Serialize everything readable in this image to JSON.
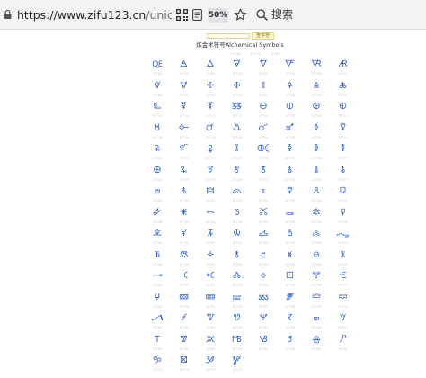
{
  "browser": {
    "url_host": "https://www.zifu123.cn",
    "url_path": "/unicode/Alchemical",
    "zoom": "50%",
    "search_label": "搜索"
  },
  "page": {
    "search_button": "查字符",
    "title": "炼金术符号Alchemical Symbols",
    "subcodes": [
      "1F700",
      "1F701",
      "1F702"
    ]
  },
  "symbols": [
    {
      "g": "🜀",
      "code": "1F700"
    },
    {
      "g": "🜁",
      "code": "1F701"
    },
    {
      "g": "🜂",
      "code": "1F702"
    },
    {
      "g": "🜃",
      "code": "1F703"
    },
    {
      "g": "🜄",
      "code": "1F704"
    },
    {
      "g": "🜅",
      "code": "1F705"
    },
    {
      "g": "🜆",
      "code": "1F706"
    },
    {
      "g": "🜇",
      "code": "1F707"
    },
    {
      "g": "🜈",
      "code": "1F708"
    },
    {
      "g": "🜉",
      "code": "1F709"
    },
    {
      "g": "🜊",
      "code": "1F70A"
    },
    {
      "g": "🜋",
      "code": "1F70B"
    },
    {
      "g": "🜌",
      "code": "1F70C"
    },
    {
      "g": "🜍",
      "code": "1F70D"
    },
    {
      "g": "🜎",
      "code": "1F70E"
    },
    {
      "g": "🜏",
      "code": "1F70F"
    },
    {
      "g": "🜐",
      "code": "1F710"
    },
    {
      "g": "🜑",
      "code": "1F711"
    },
    {
      "g": "🜒",
      "code": "1F712"
    },
    {
      "g": "🜓",
      "code": "1F713"
    },
    {
      "g": "🜔",
      "code": "1F714"
    },
    {
      "g": "🜕",
      "code": "1F715"
    },
    {
      "g": "🜖",
      "code": "1F716"
    },
    {
      "g": "🜗",
      "code": "1F717"
    },
    {
      "g": "🜘",
      "code": "1F718"
    },
    {
      "g": "🜙",
      "code": "1F719"
    },
    {
      "g": "🜚",
      "code": "1F71A"
    },
    {
      "g": "🜛",
      "code": "1F71B"
    },
    {
      "g": "🜜",
      "code": "1F71C"
    },
    {
      "g": "🜝",
      "code": "1F71D"
    },
    {
      "g": "🜞",
      "code": "1F71E"
    },
    {
      "g": "🜟",
      "code": "1F71F"
    },
    {
      "g": "🜠",
      "code": "1F720"
    },
    {
      "g": "🜡",
      "code": "1F721"
    },
    {
      "g": "🜢",
      "code": "1F722"
    },
    {
      "g": "🜣",
      "code": "1F723"
    },
    {
      "g": "🜤",
      "code": "1F724"
    },
    {
      "g": "🜥",
      "code": "1F725"
    },
    {
      "g": "🜦",
      "code": "1F726"
    },
    {
      "g": "🜧",
      "code": "1F727"
    },
    {
      "g": "🜨",
      "code": "1F728"
    },
    {
      "g": "🜩",
      "code": "1F729"
    },
    {
      "g": "🜪",
      "code": "1F72A"
    },
    {
      "g": "🜫",
      "code": "1F72B"
    },
    {
      "g": "🜬",
      "code": "1F72C"
    },
    {
      "g": "🜭",
      "code": "1F72D"
    },
    {
      "g": "🜮",
      "code": "1F72E"
    },
    {
      "g": "🜯",
      "code": "1F72F"
    },
    {
      "g": "🜰",
      "code": "1F730"
    },
    {
      "g": "🜱",
      "code": "1F731"
    },
    {
      "g": "🜲",
      "code": "1F732"
    },
    {
      "g": "🜳",
      "code": "1F733"
    },
    {
      "g": "🜴",
      "code": "1F734"
    },
    {
      "g": "🜵",
      "code": "1F735"
    },
    {
      "g": "🜶",
      "code": "1F736"
    },
    {
      "g": "🜷",
      "code": "1F737"
    },
    {
      "g": "🜸",
      "code": "1F738"
    },
    {
      "g": "🜹",
      "code": "1F739"
    },
    {
      "g": "🜺",
      "code": "1F73A"
    },
    {
      "g": "🜻",
      "code": "1F73B"
    },
    {
      "g": "🜼",
      "code": "1F73C"
    },
    {
      "g": "🜽",
      "code": "1F73D"
    },
    {
      "g": "🜾",
      "code": "1F73E"
    },
    {
      "g": "🜿",
      "code": "1F73F"
    },
    {
      "g": "🝀",
      "code": "1F740"
    },
    {
      "g": "🝁",
      "code": "1F741"
    },
    {
      "g": "🝂",
      "code": "1F742"
    },
    {
      "g": "🝃",
      "code": "1F743"
    },
    {
      "g": "🝄",
      "code": "1F744"
    },
    {
      "g": "🝅",
      "code": "1F745"
    },
    {
      "g": "🝆",
      "code": "1F746"
    },
    {
      "g": "🝇",
      "code": "1F747"
    },
    {
      "g": "🝈",
      "code": "1F748"
    },
    {
      "g": "🝉",
      "code": "1F749"
    },
    {
      "g": "🝊",
      "code": "1F74A"
    },
    {
      "g": "🝋",
      "code": "1F74B"
    },
    {
      "g": "🝌",
      "code": "1F74C"
    },
    {
      "g": "🝍",
      "code": "1F74D"
    },
    {
      "g": "🝎",
      "code": "1F74E"
    },
    {
      "g": "🝏",
      "code": "1F74F"
    },
    {
      "g": "🝐",
      "code": "1F750"
    },
    {
      "g": "🝑",
      "code": "1F751"
    },
    {
      "g": "🝒",
      "code": "1F752"
    },
    {
      "g": "🝓",
      "code": "1F753"
    },
    {
      "g": "🝔",
      "code": "1F754"
    },
    {
      "g": "🝕",
      "code": "1F755"
    },
    {
      "g": "🝖",
      "code": "1F756"
    },
    {
      "g": "🝗",
      "code": "1F757"
    },
    {
      "g": "🝘",
      "code": "1F758"
    },
    {
      "g": "🝙",
      "code": "1F759"
    },
    {
      "g": "🝚",
      "code": "1F75A"
    },
    {
      "g": "🝛",
      "code": "1F75B"
    },
    {
      "g": "🝜",
      "code": "1F75C"
    },
    {
      "g": "🝝",
      "code": "1F75D"
    },
    {
      "g": "🝞",
      "code": "1F75E"
    },
    {
      "g": "🝟",
      "code": "1F75F"
    },
    {
      "g": "🝠",
      "code": "1F760"
    },
    {
      "g": "🝡",
      "code": "1F761"
    },
    {
      "g": "🝢",
      "code": "1F762"
    },
    {
      "g": "🝣",
      "code": "1F763"
    },
    {
      "g": "🝤",
      "code": "1F764"
    },
    {
      "g": "🝥",
      "code": "1F765"
    },
    {
      "g": "🝦",
      "code": "1F766"
    },
    {
      "g": "🝧",
      "code": "1F767"
    },
    {
      "g": "🝨",
      "code": "1F768"
    },
    {
      "g": "🝩",
      "code": "1F769"
    },
    {
      "g": "🝪",
      "code": "1F76A"
    },
    {
      "g": "🝫",
      "code": "1F76B"
    },
    {
      "g": "🝬",
      "code": "1F76C"
    },
    {
      "g": "🝭",
      "code": "1F76D"
    },
    {
      "g": "🝮",
      "code": "1F76E"
    },
    {
      "g": "🝯",
      "code": "1F76F"
    },
    {
      "g": "🝰",
      "code": "1F770"
    },
    {
      "g": "🝱",
      "code": "1F771"
    },
    {
      "g": "🝲",
      "code": "1F772"
    },
    {
      "g": "🝳",
      "code": "1F773"
    }
  ],
  "colors": {
    "symbol": "#2f5ec4",
    "code_text": "#c8c8c8",
    "toolbar_bg": "#f3f3f5"
  }
}
